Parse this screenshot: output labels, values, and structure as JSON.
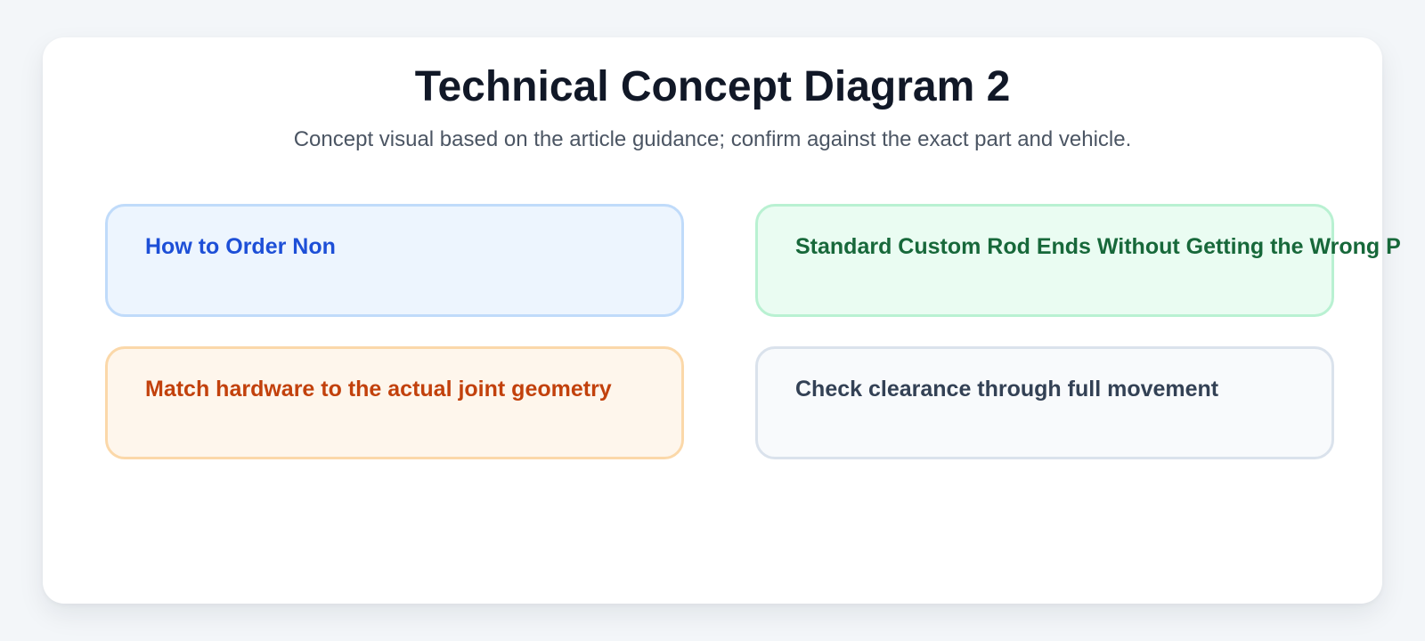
{
  "title": "Technical Concept Diagram 2",
  "subtitle": "Concept visual based on the article guidance; confirm against the exact part and vehicle.",
  "boxes": [
    {
      "label": "How to Order Non",
      "accent": "#1d4fd7"
    },
    {
      "label": "Standard Custom Rod Ends Without Getting the Wrong P",
      "accent": "#17683a"
    },
    {
      "label": "Match hardware to the actual joint geometry",
      "accent": "#c2410c"
    },
    {
      "label": "Check clearance through full movement",
      "accent": "#334155"
    }
  ]
}
